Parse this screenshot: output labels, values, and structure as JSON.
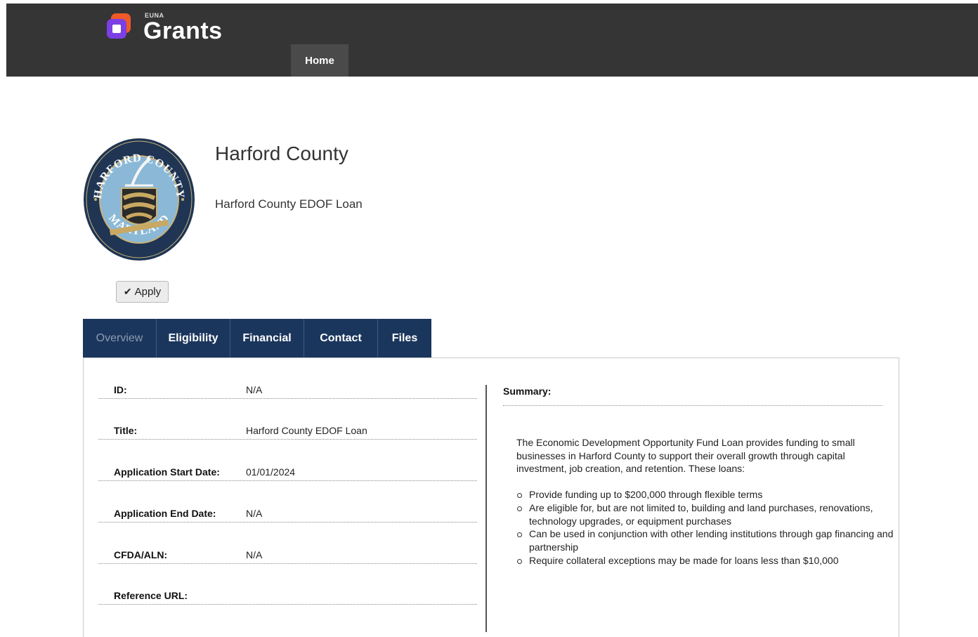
{
  "header": {
    "logo_small": "EUNA",
    "logo_big": "Grants",
    "nav": [
      {
        "label": "Home"
      }
    ]
  },
  "org": {
    "name": "Harford County",
    "grant_title": "Harford County EDOF Loan",
    "seal_text_top": "HARFORD COUNTY",
    "seal_text_bottom": "MARYLAND"
  },
  "actions": {
    "apply_label": "Apply"
  },
  "tabs": [
    {
      "label": "Overview",
      "active": true
    },
    {
      "label": "Eligibility"
    },
    {
      "label": "Financial"
    },
    {
      "label": "Contact"
    },
    {
      "label": "Files"
    }
  ],
  "fields": [
    {
      "label": "ID:",
      "value": "N/A"
    },
    {
      "label": "Title:",
      "value": "Harford County EDOF Loan"
    },
    {
      "label": "Application Start Date:",
      "value": "01/01/2024"
    },
    {
      "label": "Application End Date:",
      "value": "N/A"
    },
    {
      "label": "CFDA/ALN:",
      "value": "N/A"
    },
    {
      "label": "Reference URL:",
      "value": ""
    }
  ],
  "summary": {
    "title": "Summary:",
    "intro": "The Economic Development Opportunity Fund Loan provides funding to small businesses in Harford County to support their overall growth through capital investment, job creation, and retention. These loans:",
    "bullets": [
      "Provide funding up to $200,000 through flexible terms",
      "Are eligible for, but are not limited to, building and land purchases, renovations, technology upgrades, or equipment purchases",
      "Can be used in conjunction with other lending institutions through gap financing and partnership",
      "Require collateral exceptions may be made for loans less than $10,000"
    ]
  },
  "colors": {
    "topbar": "#353535",
    "tab_bg": "#1b365d",
    "logo_orange": "#f05a28",
    "logo_purple": "#7b3fe4"
  }
}
